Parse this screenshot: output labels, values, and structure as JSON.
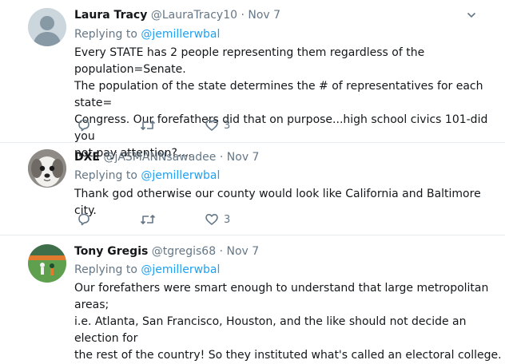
{
  "tweets": [
    {
      "name": "Laura Tracy",
      "handle": "@LauraTracy10",
      "dot": "·",
      "time": "Nov 7",
      "replying_prefix": "Replying to",
      "replying_to": "@jemillerwbal",
      "lines": [
        "Every STATE has 2 people representing them regardless of the population=Senate.",
        "The population of the state determines the # of representatives for each state=",
        "Congress.  Our forefathers did that on purpose...high school civics 101-did you",
        "not pay attention?...."
      ],
      "likes": "3"
    },
    {
      "name": "DXE",
      "handle": "@jASMANNsawadee",
      "dot": "·",
      "time": "Nov 7",
      "replying_prefix": "Replying to",
      "replying_to": "@jemillerwbal",
      "lines": [
        "Thank god otherwise our county would look like California and Baltimore city."
      ],
      "likes": "3"
    },
    {
      "name": "Tony Gregis",
      "handle": "@tgregis68",
      "dot": "·",
      "time": "Nov 7",
      "replying_prefix": "Replying to",
      "replying_to": "@jemillerwbal",
      "lines": [
        "Our forefathers were smart enough to understand that large metropolitan areas;",
        "i.e. Atlanta, San Francisco, Houston, and the like should not decide an election for",
        "the rest of the country! So they instituted what's called an electoral college."
      ]
    }
  ],
  "colors": {
    "accent": "#1da1f2",
    "muted": "#657786",
    "text": "#14171a",
    "divider": "#e6ecf0"
  },
  "icons": [
    "chevron-down-icon",
    "reply-icon",
    "retweet-icon",
    "heart-icon"
  ]
}
